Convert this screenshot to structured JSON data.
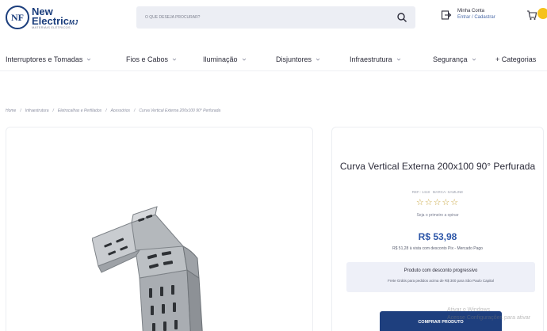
{
  "header": {
    "logo": {
      "mark": "NF",
      "line1": "New",
      "line2": "Electric",
      "line2_suffix": "MJ",
      "tagline": "MATERIAIS ELÉTRICOS"
    },
    "search": {
      "placeholder": "O QUE DESEJA PROCURAR?"
    },
    "account": {
      "title": "Minha Conta",
      "subtitle": "Entrar / Cadastrar"
    }
  },
  "nav": {
    "items": [
      {
        "label": "Interruptores e Tomadas"
      },
      {
        "label": "Fios e Cabos"
      },
      {
        "label": "Iluminação"
      },
      {
        "label": "Disjuntores"
      },
      {
        "label": "Infraestrutura"
      },
      {
        "label": "Segurança"
      },
      {
        "label": "+ Categorias"
      }
    ]
  },
  "breadcrumb": [
    "Home",
    "Infraestrutura",
    "Eletrocalhas e Perfilados",
    "Acessórios",
    "Curva Vertical Externa 200x100 90° Perfurada"
  ],
  "product": {
    "title": "Curva Vertical Externa 200x100 90° Perfurada",
    "ref": "REF.: 1418",
    "brand": "MARCA: SAMLINE",
    "rating_stars": "☆☆☆☆☆",
    "review_cta": "Seja o primeiro a opinar",
    "price": "R$ 53,98",
    "price_pix": "R$ 51,28 à vista com desconto Pix - Mercado Pago",
    "promo_title": "Produto com desconto progressivo",
    "promo_text": "Frete Grátis para pedidos acima de R$ 300 para São Paulo Capital",
    "buy_label": "COMPRAR PRODUTO"
  },
  "watermark": {
    "line1": "Ativar o Windows",
    "line2": "Acesse Configurações para ativar"
  },
  "colors": {
    "brand": "#1a3d7c",
    "accent": "#2d56a8",
    "badge": "#f6c21c"
  }
}
